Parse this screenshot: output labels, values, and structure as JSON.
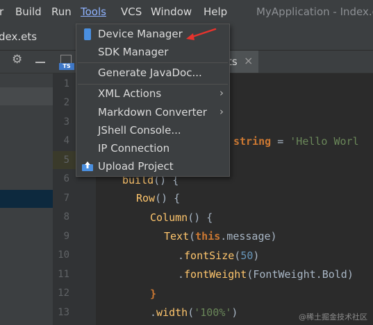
{
  "menubar": {
    "items": [
      "r",
      "Build",
      "Run",
      "Tools",
      "VCS",
      "Window",
      "Help"
    ],
    "window_title": "MyApplication - Index.et"
  },
  "filetab": {
    "name": "dex.ets"
  },
  "editor_tab": {
    "name": "ts",
    "close": "×"
  },
  "toolbar": {
    "ts_badge": "TS"
  },
  "tools_menu": {
    "items": [
      {
        "label": "Device Manager",
        "icon": "phone-icon"
      },
      {
        "label": "SDK Manager"
      },
      {
        "label": "Generate JavaDoc..."
      },
      {
        "label": "XML Actions",
        "submenu": "›"
      },
      {
        "label": "Markdown Converter",
        "submenu": "›"
      },
      {
        "label": "JShell Console..."
      },
      {
        "label": "IP Connection"
      },
      {
        "label": "Upload Project",
        "icon": "upload-icon"
      }
    ]
  },
  "code": {
    "line_numbers": [
      "1",
      "2",
      "3",
      "4",
      "5",
      "6",
      "7",
      "8",
      "9",
      "10",
      "11",
      "12",
      "13"
    ],
    "line4_type": "string",
    "line4_op": " = ",
    "line4_value": "'Hello Worl",
    "line6_a": "build",
    "line6_b": "() {",
    "line7_a": "Row",
    "line7_b": "() {",
    "line8_a": "Column",
    "line8_b": "() {",
    "line9_a": "Text",
    "line9_b": "(",
    "line9_c": "this",
    "line9_d": ".message)",
    "line10_a": ".",
    "line10_b": "fontSize",
    "line10_c": "(",
    "line10_d": "50",
    "line10_e": ")",
    "line11_a": ".",
    "line11_b": "fontWeight",
    "line11_c": "(FontWeight.Bold)",
    "line12_a": "}",
    "line13_a": ".",
    "line13_b": "width",
    "line13_c": "(",
    "line13_d": "'100%'",
    "line13_e": ")"
  },
  "watermark": "@稀土掘金技术社区",
  "colors": {
    "accent": "#8fb3ff",
    "annotation_arrow": "#e8332d",
    "ts_badge": "#3f78c8"
  }
}
